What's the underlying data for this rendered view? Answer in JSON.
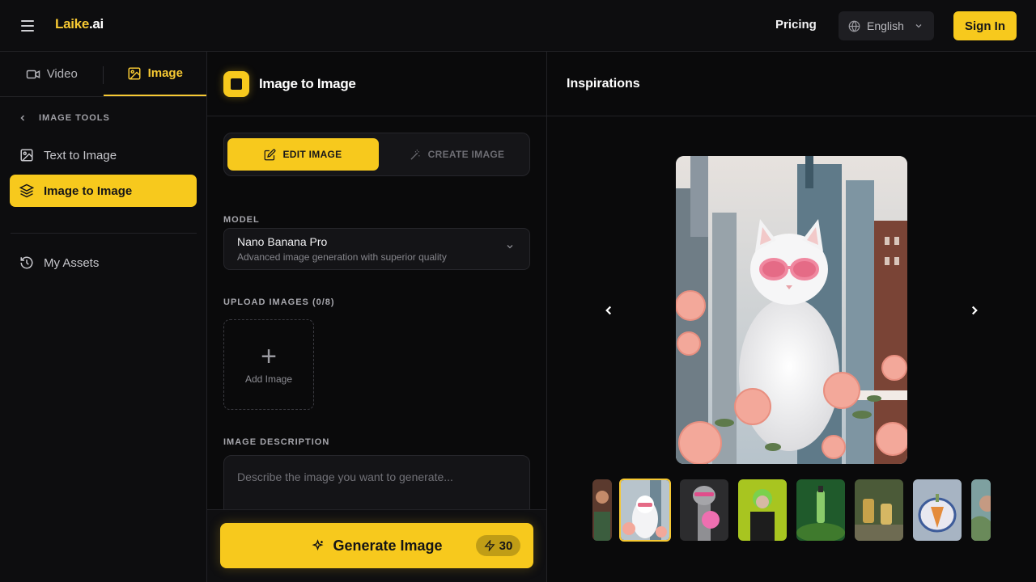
{
  "header": {
    "logo_part1": "Laike",
    "logo_part2": ".ai",
    "pricing": "Pricing",
    "language": "English",
    "sign_in": "Sign In"
  },
  "sidebar": {
    "tabs": [
      {
        "label": "Video",
        "icon": "video-icon",
        "active": false
      },
      {
        "label": "Image",
        "icon": "image-icon",
        "active": true
      }
    ],
    "section": "IMAGE TOOLS",
    "items": [
      {
        "label": "Text to Image",
        "icon": "image-icon",
        "active": false
      },
      {
        "label": "Image to Image",
        "icon": "layers-icon",
        "active": true
      }
    ],
    "assets": {
      "label": "My Assets",
      "icon": "history-icon"
    }
  },
  "panel": {
    "title": "Image to Image",
    "mode_edit": "EDIT IMAGE",
    "mode_create": "CREATE IMAGE",
    "model_label": "MODEL",
    "model_name": "Nano Banana Pro",
    "model_desc": "Advanced image generation with superior quality",
    "upload_label": "UPLOAD IMAGES (0/8)",
    "upload_button": "Add Image",
    "description_label": "IMAGE DESCRIPTION",
    "description_placeholder": "Describe the image you want to generate...",
    "description_value": "",
    "generate_label": "Generate Image",
    "credits": "30"
  },
  "inspirations": {
    "title": "Inspirations",
    "selected_index": 1,
    "thumbnails": [
      "group-photo",
      "white-cat-sunglasses",
      "giraffe-bubblegum",
      "green-hair-portrait",
      "green-bottle-moss",
      "product-bottles",
      "porcelain-pumpkin",
      "woman-portrait"
    ]
  },
  "colors": {
    "accent": "#f7c91d",
    "background": "#0d0d0f",
    "panel": "#141417"
  }
}
